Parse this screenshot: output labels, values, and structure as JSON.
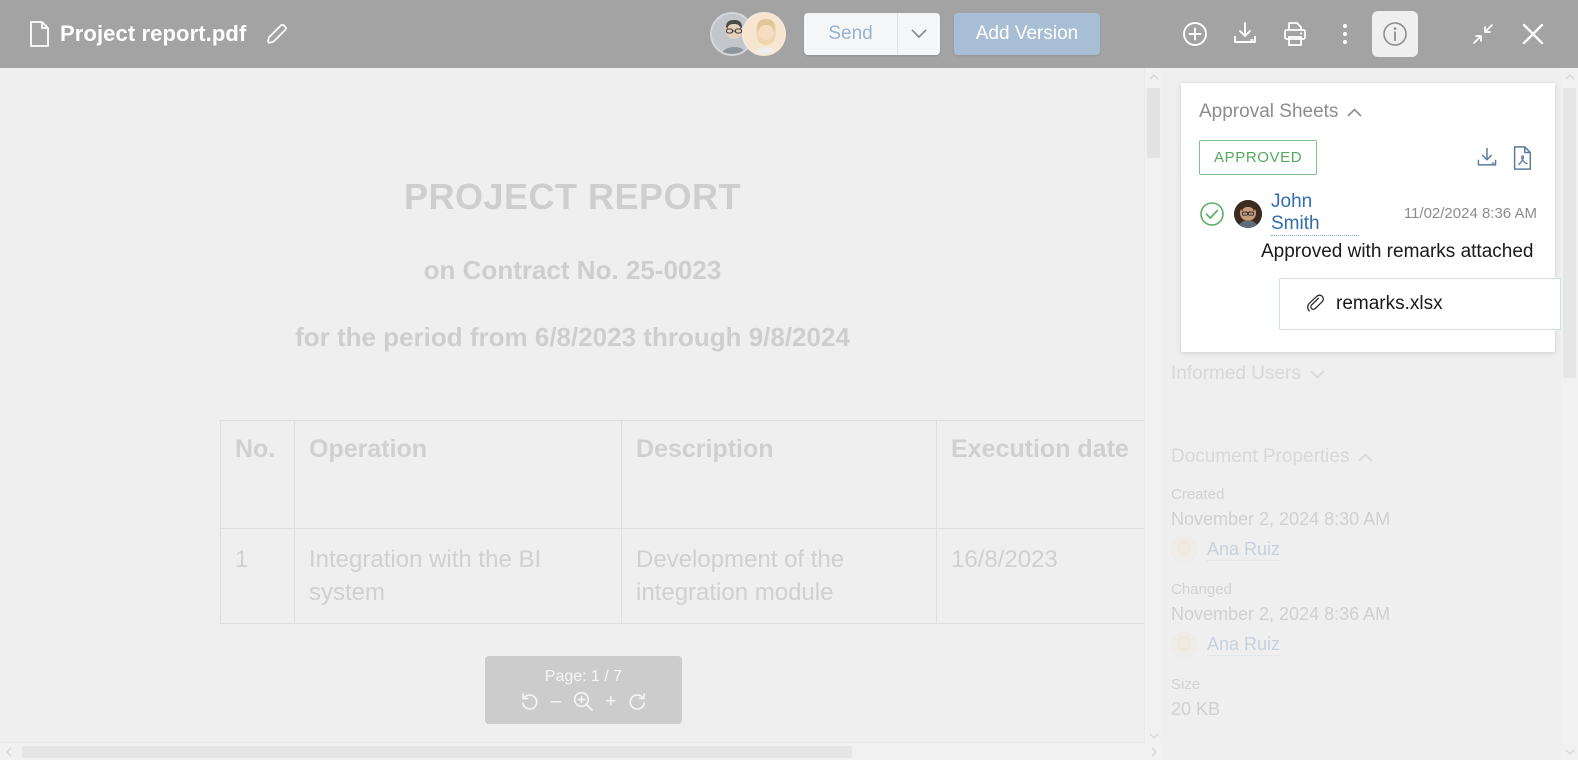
{
  "topbar": {
    "file_icon": "document-icon",
    "title": "Project report.pdf",
    "rename_icon": "pencil-icon",
    "avatars": [
      {
        "name": "avatar-user-1"
      },
      {
        "name": "avatar-user-2"
      }
    ],
    "send_label": "Send",
    "send_caret_icon": "chevron-down-icon",
    "add_version_label": "Add Version",
    "icons": [
      {
        "name": "add-icon"
      },
      {
        "name": "download-icon"
      },
      {
        "name": "print-icon"
      },
      {
        "name": "more-options-icon"
      },
      {
        "name": "info-icon",
        "active": true
      },
      {
        "name": "collapse-icon"
      },
      {
        "name": "close-icon"
      }
    ],
    "colors": {
      "bar_bg": "#a3a3a3",
      "add_version_bg": "#a8bed4",
      "send_text": "#9bb2cc"
    }
  },
  "document": {
    "title": "PROJECT REPORT",
    "subtitle": "on Contract No. 25-0023",
    "period": "for the period from 6/8/2023 through 9/8/2024",
    "table": {
      "headers": [
        "No.",
        "Operation",
        "Description",
        "Execution date"
      ],
      "rows": [
        [
          "1",
          "Integration with the BI system",
          "Development of the integration module",
          "16/8/2023"
        ]
      ]
    },
    "pagebar": {
      "page_label": "Page: 1 / 7",
      "tools": [
        {
          "name": "rotate-left-icon"
        },
        {
          "name": "zoom-out-icon",
          "glyph": "–"
        },
        {
          "name": "magnifier-icon"
        },
        {
          "name": "zoom-in-icon",
          "glyph": "+"
        },
        {
          "name": "rotate-right-icon"
        }
      ]
    }
  },
  "sidebar": {
    "approval": {
      "section_title": "Approval Sheets",
      "chevron": "chevron-up-icon",
      "status_badge": "APPROVED",
      "status_color": "#56a860",
      "actions": [
        {
          "name": "download-sheet-icon"
        },
        {
          "name": "export-pdf-icon"
        }
      ],
      "approver_name": "John Smith",
      "approver_time": "11/02/2024 8:36 AM",
      "approver_note": "Approved with remarks attached",
      "attachment": {
        "icon": "paperclip-icon",
        "name": "remarks.xlsx"
      }
    },
    "informed_users": {
      "section_title": "Informed Users",
      "chevron": "chevron-down-icon"
    },
    "document_properties": {
      "section_title": "Document Properties",
      "chevron": "chevron-up-icon",
      "created_label": "Created",
      "created_value": "November 2, 2024 8:30 AM",
      "created_user": "Ana Ruiz",
      "changed_label": "Changed",
      "changed_value": "November 2, 2024 8:36 AM",
      "changed_user": "Ana Ruiz",
      "size_label": "Size",
      "size_value": "20 KB"
    }
  }
}
